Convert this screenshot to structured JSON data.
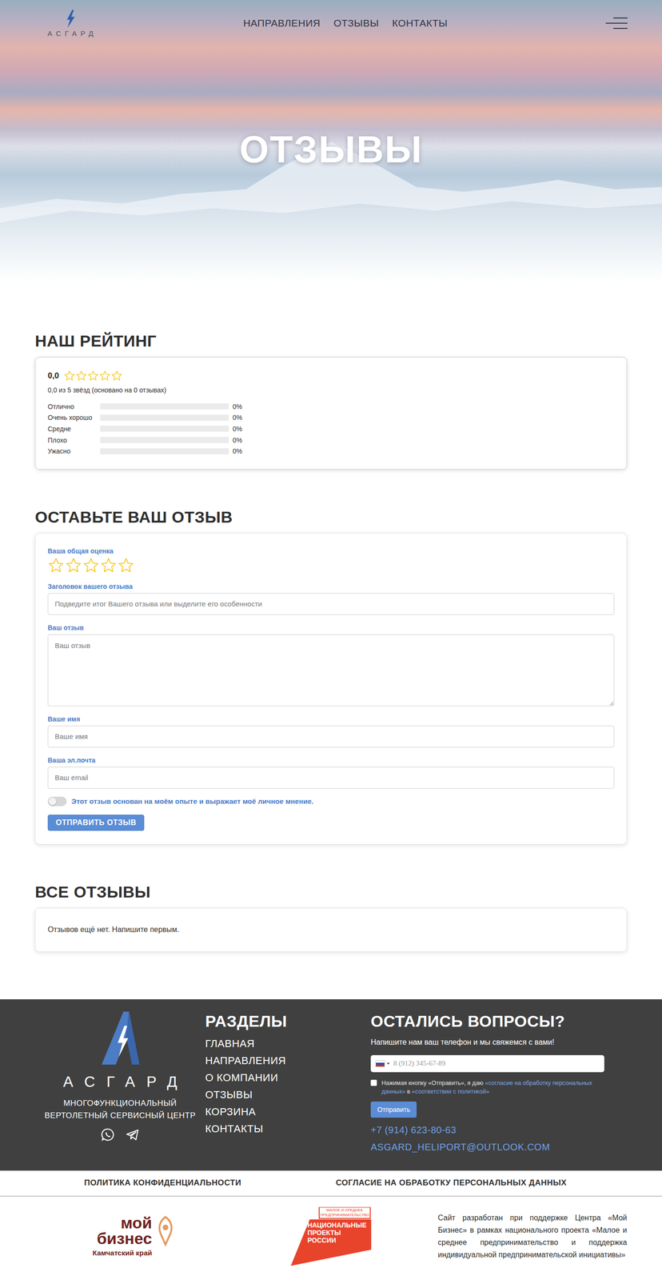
{
  "header": {
    "logo": "АСГАРД",
    "nav": [
      {
        "label": "НАПРАВЛЕНИЯ",
        "selected": false
      },
      {
        "label": "ОТЗЫВЫ",
        "selected": false
      },
      {
        "label": "КОНТАКТЫ",
        "selected": false
      }
    ]
  },
  "hero": {
    "title": "ОТЗЫВЫ"
  },
  "rating": {
    "heading": "НАШ РЕЙТИНГ",
    "score": "0,0",
    "stars": 0,
    "summary": "0,0 из 5 звёзд (основано на 0 отзывах)",
    "rows": [
      {
        "label": "Отлично",
        "level": 0,
        "reading": "0%"
      },
      {
        "label": "Очень хорошо",
        "level": 0,
        "reading": "0%"
      },
      {
        "label": "Средне",
        "level": 0,
        "reading": "0%"
      },
      {
        "label": "Плохо",
        "level": 0,
        "reading": "0%"
      },
      {
        "label": "Ужасно",
        "level": 0,
        "reading": "0%"
      }
    ]
  },
  "review_form": {
    "heading": "ОСТАВЬТЕ ВАШ ОТЗЫВ",
    "rating_label": "Ваша общая оценка",
    "stars": 0,
    "fields": [
      {
        "label": "Заголовок вашего отзыва",
        "placeholder": "Подведите итог Вашего отзыва или выделите его особенности",
        "kind": "input"
      },
      {
        "label": "Ваш отзыв",
        "placeholder": "Ваш отзыв",
        "kind": "textarea"
      },
      {
        "label": "Ваше имя",
        "placeholder": "Ваше имя",
        "kind": "input"
      },
      {
        "label": "Ваша эл.почта",
        "placeholder": "Ваш email",
        "kind": "input"
      }
    ],
    "consent": {
      "text": "Этот отзыв основан на моём опыте и выражает моё личное мнение.",
      "on": false
    },
    "submit": "ОТПРАВИТЬ ОТЗЫВ"
  },
  "reviews": {
    "heading": "ВСЕ ОТЗЫВЫ",
    "empty": "Отзывов ещё нет. Напишите первым."
  },
  "footer": {
    "brand": {
      "name": "АСГАРД",
      "tagline": [
        "МНОГОФУНКЦИОНАЛЬНЫЙ",
        "ВЕРТОЛЕТНЫЙ СЕРВИСНЫЙ ЦЕНТР"
      ]
    },
    "sections": {
      "heading": "РАЗДЕЛЫ",
      "links": [
        "ГЛАВНАЯ",
        "НАПРАВЛЕНИЯ",
        "О КОМПАНИИ",
        "ОТЗЫВЫ",
        "КОРЗИНА",
        "КОНТАКТЫ"
      ]
    },
    "callback": {
      "heading": "ОСТАЛИСЬ ВОПРОСЫ?",
      "text": "Напишите нам ваш телефон и мы свяжемся с вами!",
      "phone_placeholder": "8 (912) 345-67-89",
      "consent": {
        "checked": false,
        "parts": [
          {
            "text": "Нажимая кнопку «Отправить», я даю ",
            "link": false
          },
          {
            "text": "«согласие на обработку персональных данных»",
            "link": true
          },
          {
            "text": " в ",
            "link": false
          },
          {
            "text": "«соответствии с политикой»",
            "link": true
          }
        ]
      },
      "submit": "Отправить",
      "phone": "+7 (914) 623-80-63",
      "email": "ASGARD_HELIPORT@OUTLOOK.COM"
    }
  },
  "legal": {
    "links": [
      "ПОЛИТИКА КОНФИДЕНЦИАЛЬНОСТИ",
      "СОГЛАСИЕ НА ОБРАБОТКУ ПЕРСОНАЛЬНЫХ ДАННЫХ"
    ]
  },
  "partners": {
    "my_business": {
      "top": "мой",
      "bottom": "бизнес",
      "region": "Камчатский край"
    },
    "national_projects": {
      "caption": "МАЛОЕ И СРЕДНЕЕ ПРЕДПРИНИМАТЕЛЬСТВО",
      "title": "НАЦИОНАЛЬНЫЕ ПРОЕКТЫ РОССИИ"
    },
    "credit": "Сайт разработан при поддержке Центра «Мой Бизнес» в рамках национального проекта «Малое и среднее предпринимательство и поддержка индивидуальной предпринимательской инициативы»"
  }
}
